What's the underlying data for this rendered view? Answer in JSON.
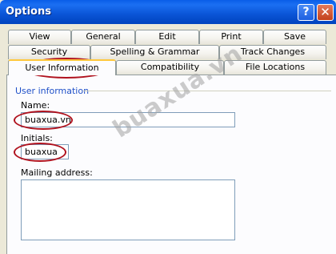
{
  "window": {
    "title": "Options",
    "help_glyph": "?",
    "close_glyph": "✕"
  },
  "tabs": {
    "row1": [
      "View",
      "General",
      "Edit",
      "Print",
      "Save"
    ],
    "row2": [
      "Security",
      "Spelling & Grammar",
      "Track Changes"
    ],
    "row3": [
      "User Information",
      "Compatibility",
      "File Locations"
    ],
    "selected": "User Information"
  },
  "user_info": {
    "group_label": "User information",
    "name_label": "Name:",
    "name_value": "buaxua.vn",
    "initials_label": "Initials:",
    "initials_value": "buaxua",
    "mailing_label": "Mailing address:",
    "mailing_value": ""
  },
  "watermark": "buaxua.vn",
  "colors": {
    "title_bar": "#0a54d6",
    "annotation_circle": "#b0121e",
    "group_label": "#1f50c8"
  }
}
